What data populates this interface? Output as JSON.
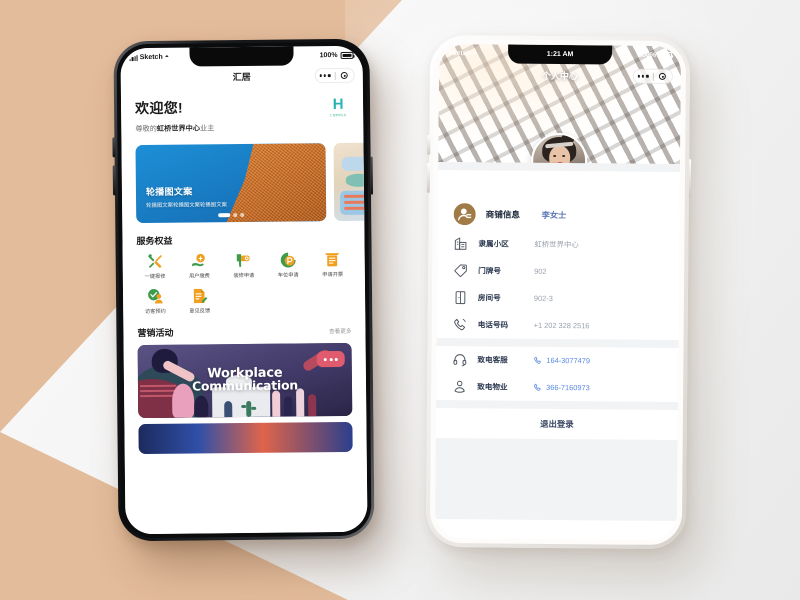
{
  "scene": {
    "background_tan": "#e3bc9b",
    "background_light": "#f2f2f2"
  },
  "left_phone": {
    "status_bar": {
      "carrier": "Sketch",
      "signal_icon": "signal-bars-icon",
      "wifi_icon": "wifi-icon",
      "battery_percent": "100%",
      "battery_icon": "battery-icon"
    },
    "capsule": {
      "more_icon": "more-dots-icon",
      "target_icon": "target-circle-icon"
    },
    "nav": {
      "title": "汇居"
    },
    "welcome": {
      "greeting": "欢迎您!",
      "subtitle_prefix": "尊敬的",
      "subtitle_property": "虹桥世界中心",
      "subtitle_suffix": "业主",
      "logo_mark": "H",
      "logo_sub": "汇居智慧社区"
    },
    "carousel": {
      "title": "轮播图文案",
      "subtitle": "轮播图文案轮播图文案轮播图文案",
      "dots": 3,
      "active_dot": 0
    },
    "services": {
      "heading": "服务权益",
      "items": [
        {
          "label": "一键报修",
          "icon": "wrench-screwdriver-icon",
          "color": "#f0a020"
        },
        {
          "label": "用户缴费",
          "icon": "hand-coin-icon",
          "color": "#f0a020"
        },
        {
          "label": "装修申请",
          "icon": "drill-icon",
          "color": "#f0a020"
        },
        {
          "label": "车位申请",
          "icon": "parking-icon",
          "color": "#3f9b4c"
        },
        {
          "label": "申请开票",
          "icon": "invoice-icon",
          "color": "#f0a020"
        },
        {
          "label": "访客预约",
          "icon": "visitor-icon",
          "color": "#3f9b4c"
        },
        {
          "label": "意见反馈",
          "icon": "feedback-doc-icon",
          "color": "#f0a020"
        }
      ]
    },
    "marketing": {
      "heading": "营销活动",
      "more_label": "查看更多",
      "banner_line1": "Workplace",
      "banner_line2": "Communication"
    }
  },
  "right_phone": {
    "status_bar": {
      "carrier": "Sketch",
      "wifi_icon": "wifi-icon",
      "time": "1:21 AM",
      "battery_percent": "100%",
      "battery_icon": "battery-icon"
    },
    "capsule": {
      "more_icon": "more-dots-icon",
      "target_icon": "target-circle-icon"
    },
    "nav": {
      "title": "个人中心"
    },
    "avatar": {
      "icon": "user-avatar-photo"
    },
    "profile": {
      "header": {
        "icon": "profile-badge-icon",
        "key": "商铺信息",
        "value": "李女士"
      },
      "rows": [
        {
          "icon": "building-icon",
          "key": "隶属小区",
          "value": "虹桥世界中心"
        },
        {
          "icon": "tag-icon",
          "key": "门牌号",
          "value": "902"
        },
        {
          "icon": "door-icon",
          "key": "房间号",
          "value": "902-3"
        },
        {
          "icon": "phone-icon",
          "key": "电话号码",
          "value": "+1 202 328 2516"
        }
      ]
    },
    "contacts": {
      "rows": [
        {
          "icon": "headset-icon",
          "key": "致电客服",
          "value": "164-3077479",
          "action_icon": "call-icon"
        },
        {
          "icon": "person-icon",
          "key": "致电物业",
          "value": "366-7160973",
          "action_icon": "call-icon"
        }
      ]
    },
    "logout": {
      "label": "退出登录"
    }
  }
}
